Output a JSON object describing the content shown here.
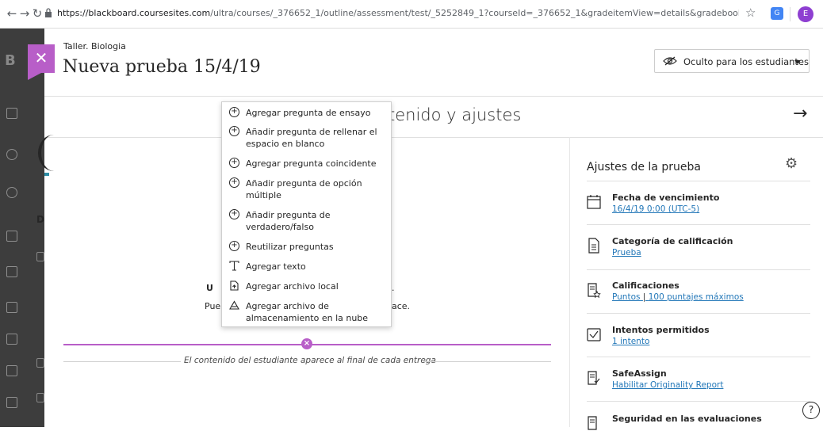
{
  "browser": {
    "url_host": "https://blackboard.coursesites.com",
    "url_path": "/ultra/courses/_376652_1/outline/assessment/test/_5252849_1?courseId=_376652_1&gradeitemView=details&gradebookCategoryId=_...",
    "profile_initial": "E"
  },
  "course": {
    "label": "Taller. Biologia"
  },
  "page": {
    "title": "Nueva prueba 15/4/19",
    "close_glyph": "✕"
  },
  "visibility": {
    "label": "Oculto para los estudiantes"
  },
  "content": {
    "heading": "tenido y ajustes",
    "line1_left": "U",
    "line1_right": ".",
    "line2_left": "Pue",
    "line2_right": "ace.",
    "student_note": "El contenido del estudiante aparece al final de cada entrega"
  },
  "left_strip": {
    "letter_b": "B",
    "letter_d": "D"
  },
  "menu": {
    "items": [
      {
        "label": "Agregar pregunta de ensayo",
        "icon": "plus-circle-icon"
      },
      {
        "label": "Añadir pregunta de rellenar el espacio en blanco",
        "icon": "plus-circle-icon"
      },
      {
        "label": "Agregar pregunta coincidente",
        "icon": "plus-circle-icon"
      },
      {
        "label": "Añadir pregunta de opción múltiple",
        "icon": "plus-circle-icon"
      },
      {
        "label": "Añadir pregunta de verdadero/falso",
        "icon": "plus-circle-icon"
      },
      {
        "label": "Reutilizar preguntas",
        "icon": "plus-circle-icon"
      },
      {
        "label": "Agregar texto",
        "icon": "text-icon"
      },
      {
        "label": "Agregar archivo local",
        "icon": "file-upload-icon"
      },
      {
        "label": "Agregar archivo de almacenamiento en la nube",
        "icon": "cloud-icon"
      }
    ]
  },
  "settings": {
    "title": "Ajustes de la prueba",
    "items": [
      {
        "title": "Fecha de vencimiento",
        "link": "16/4/19 0:00 (UTC-5)",
        "icon": "calendar-icon"
      },
      {
        "title": "Categoría de calificación",
        "link": "Prueba",
        "icon": "document-icon"
      },
      {
        "title": "Calificaciones",
        "link": "Puntos",
        "link2": "100 puntajes máximos",
        "icon": "grading-icon"
      },
      {
        "title": "Intentos permitidos",
        "link": "1 intento",
        "icon": "checkbox-icon"
      },
      {
        "title": "SafeAssign",
        "link": "Habilitar Originality Report",
        "icon": "safeassign-icon"
      },
      {
        "title": "Seguridad en las evaluaciones",
        "link": "",
        "icon": "security-icon"
      }
    ]
  },
  "help": {
    "label": "?"
  }
}
